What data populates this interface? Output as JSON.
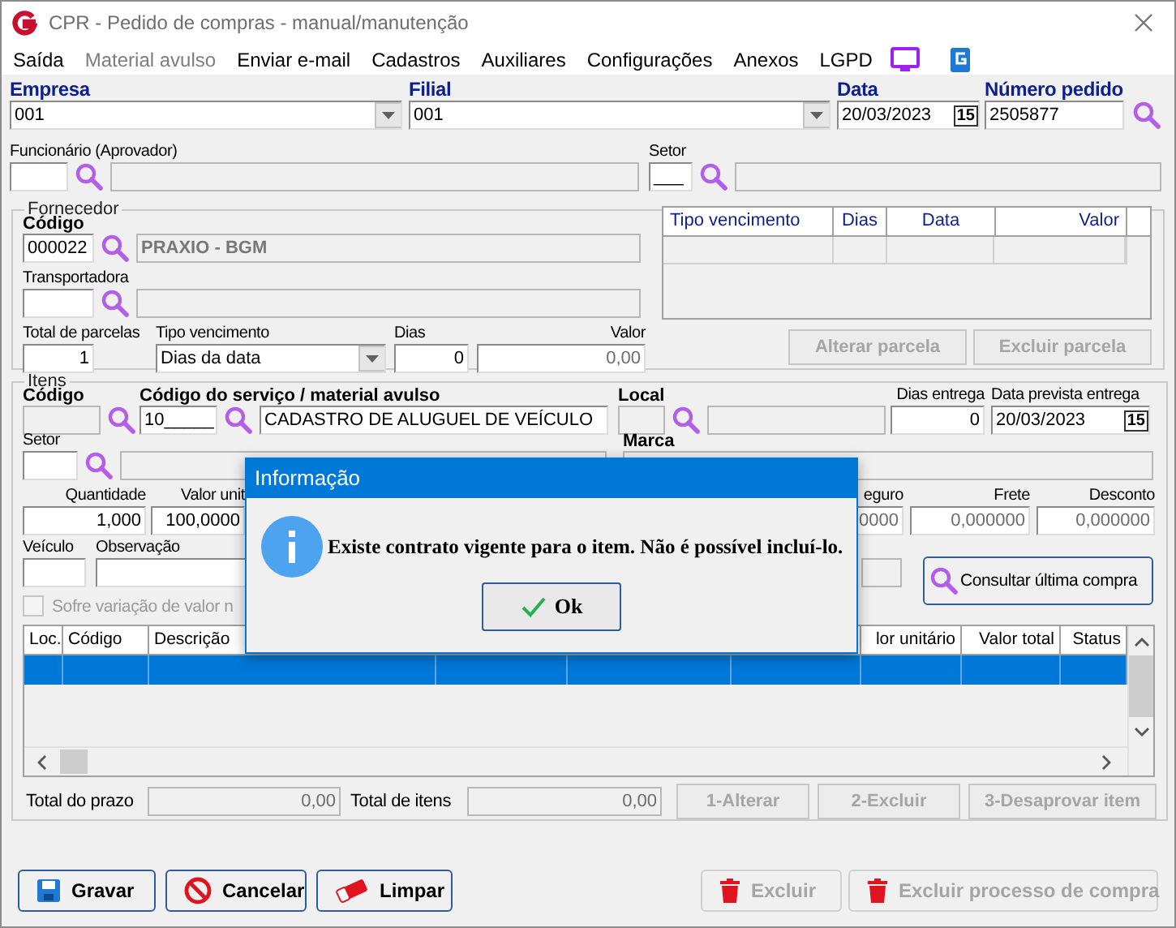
{
  "window": {
    "title": "CPR - Pedido de compras - manual/manutenção"
  },
  "menu": [
    {
      "label": "Saída",
      "disabled": false
    },
    {
      "label": "Material avulso",
      "disabled": true
    },
    {
      "label": "Enviar e-mail",
      "disabled": false
    },
    {
      "label": "Cadastros",
      "disabled": false
    },
    {
      "label": "Auxiliares",
      "disabled": false
    },
    {
      "label": "Configurações",
      "disabled": false
    },
    {
      "label": "Anexos",
      "disabled": false
    },
    {
      "label": "LGPD",
      "disabled": false
    }
  ],
  "header": [
    {
      "label": "Empresa",
      "value": "001",
      "kind": "combo",
      "disabled": false
    },
    {
      "label": "Filial",
      "value": "001",
      "kind": "combo",
      "disabled": false
    },
    {
      "label": "Data",
      "value": "20/03/2023",
      "calendar": "15",
      "disabled": false
    },
    {
      "label": "Número pedido",
      "value": "2505877",
      "kind": "text",
      "disabled": false
    }
  ],
  "funcionario": {
    "label": "Funcionário (Aprovador)",
    "code": {
      "disabled": false
    },
    "name": {
      "disabled": true
    }
  },
  "setor": {
    "label": "Setor",
    "code": {
      "value": "___",
      "disabled": false
    },
    "name": {
      "disabled": true
    }
  },
  "fornecedor": {
    "title": "Fornecedor",
    "codigo": {
      "label": "Código",
      "required": true,
      "value": "000022",
      "disabled": false
    },
    "nome": {
      "value": "PRAXIO - BGM",
      "disabled": true
    },
    "transportadora": {
      "label": "Transportadora",
      "required": false,
      "disabled": false
    },
    "transportadora_nome": {
      "disabled": true
    },
    "parcelas": [
      {
        "label": "Total de parcelas",
        "value": "1",
        "kind": "text",
        "disabled": false
      },
      {
        "label": "Tipo vencimento",
        "value": "Dias da data",
        "kind": "combo",
        "disabled": false
      },
      {
        "label": "Dias",
        "value": "0",
        "kind": "text",
        "disabled": false
      },
      {
        "label": "Valor",
        "value": "0,00",
        "kind": "readonly"
      }
    ],
    "table": {
      "columns": [
        "Tipo vencimento",
        "Dias",
        "Data",
        "Valor"
      ]
    },
    "buttons": [
      {
        "label": "Alterar parcela",
        "disabled": true
      },
      {
        "label": "Excluir parcela",
        "disabled": true
      }
    ]
  },
  "itens": {
    "title": "Itens",
    "codigo": {
      "label": "Código",
      "required": true,
      "disabled": true
    },
    "servico": {
      "label": "Código do serviço / material avulso",
      "required": true,
      "value": "10_____",
      "disabled": false
    },
    "servico_nome": {
      "value": "CADASTRO DE ALUGUEL DE VEÍCULO",
      "disabled": false
    },
    "local": {
      "label": "Local",
      "required": true,
      "disabled": true
    },
    "local_nome": {
      "disabled": true
    },
    "dias_entrega": {
      "label": "Dias entrega",
      "required": false,
      "value": "0",
      "disabled": false
    },
    "data_prevista": {
      "label": "Data prevista entrega",
      "required": false,
      "value": "20/03/2023",
      "calendar": "15",
      "disabled": false
    },
    "setor": {
      "label": "Setor",
      "required": false,
      "disabled": false
    },
    "setor_nome": {
      "disabled": true
    },
    "marca": {
      "label": "Marca",
      "required": true,
      "disabled": true
    },
    "quantidade": {
      "label": "Quantidade",
      "value": "1,000",
      "disabled": false
    },
    "valor_unitario": {
      "label": "Valor unit",
      "value": "100,0000",
      "disabled": false
    },
    "seguro": {
      "label": "eguro",
      "value": "0000",
      "kind": "readonly"
    },
    "frete": {
      "label": "Frete",
      "value": "0,000000",
      "kind": "readonly"
    },
    "desconto": {
      "label": "Desconto",
      "value": "0,000000",
      "kind": "readonly"
    },
    "veiculo": {
      "label": "Veículo",
      "disabled": false
    },
    "observacao": {
      "label": "Observação",
      "disabled": false
    },
    "extra": {
      "disabled": true
    },
    "consultar": {
      "label": "Consultar última compra",
      "disabled": false
    },
    "variacao": {
      "label": "Sofre variação de valor n",
      "checked": false,
      "disabled": true
    },
    "grid": {
      "columns": [
        "Loc.",
        "Código",
        "Descrição",
        "lor unitário",
        "Valor total",
        "Status"
      ],
      "rows": [
        {
          "selected": true
        }
      ]
    },
    "totals": [
      {
        "label": "Total do prazo",
        "value": "0,00"
      },
      {
        "label": "Total de itens",
        "value": "0,00"
      }
    ],
    "buttons": [
      {
        "label": "1-Alterar",
        "disabled": true
      },
      {
        "label": "2-Excluir",
        "disabled": true
      },
      {
        "label": "3-Desaprovar item",
        "disabled": true
      }
    ]
  },
  "footer": [
    {
      "label": "Gravar",
      "kind": "save",
      "disabled": false
    },
    {
      "label": "Cancelar",
      "kind": "cancel",
      "disabled": false
    },
    {
      "label": "Limpar",
      "kind": "clear",
      "disabled": false
    },
    {
      "label": "Excluir",
      "kind": "delete",
      "disabled": true
    },
    {
      "label": "Excluir processo de compra",
      "kind": "delete",
      "disabled": true
    }
  ],
  "dialog": {
    "title": "Informação",
    "message": "Existe contrato vigente para o item. Não é possível incluí-lo.",
    "button": "Ok"
  }
}
